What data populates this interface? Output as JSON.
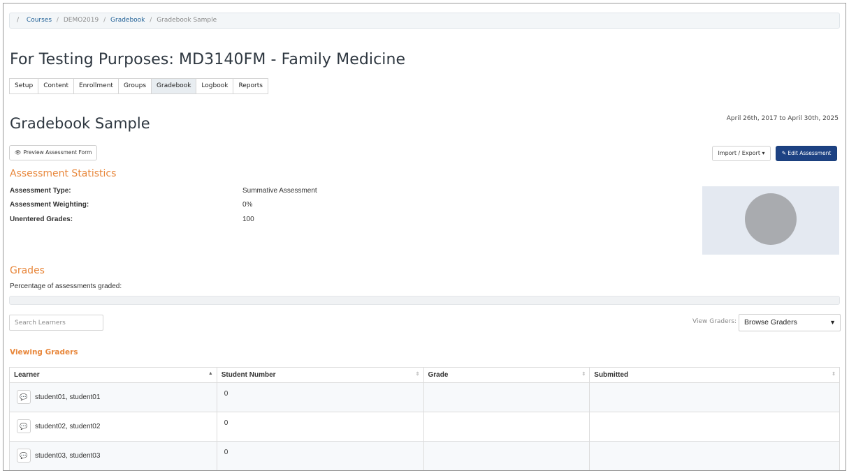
{
  "breadcrumb": {
    "lead_sep": "/",
    "items": [
      "Courses",
      "DEMO2019",
      "Gradebook",
      "Gradebook Sample"
    ],
    "sep": "/"
  },
  "course_title": "For Testing Purposes: MD3140FM - Family Medicine",
  "tabs": [
    "Setup",
    "Content",
    "Enrollment",
    "Groups",
    "Gradebook",
    "Logbook",
    "Reports"
  ],
  "active_tab": "Gradebook",
  "page_title": "Gradebook Sample",
  "date_range": "April 26th, 2017 to April 30th, 2025",
  "buttons": {
    "preview": "Preview Assessment Form",
    "import_export": "Import / Export",
    "edit": "Edit Assessment"
  },
  "stats": {
    "heading": "Assessment Statistics",
    "rows": [
      {
        "label": "Assessment Type:",
        "value": "Summative Assessment"
      },
      {
        "label": "Assessment Weighting:",
        "value": "0%"
      },
      {
        "label": "Unentered Grades:",
        "value": "100"
      }
    ]
  },
  "grades": {
    "heading": "Grades",
    "pct_label": "Percentage of assessments graded:",
    "pct_graded": 0
  },
  "search": {
    "placeholder": "Search Learners"
  },
  "view_graders": {
    "label": "View Graders:",
    "selected": "Browse Graders"
  },
  "viewing_graders_heading": "Viewing Graders",
  "table": {
    "headers": [
      "Learner",
      "Student Number",
      "Grade",
      "Submitted"
    ],
    "rows": [
      {
        "learner": "student01, student01",
        "student_number": "0",
        "grade": "",
        "submitted": ""
      },
      {
        "learner": "student02, student02",
        "student_number": "0",
        "grade": "",
        "submitted": ""
      },
      {
        "learner": "student03, student03",
        "student_number": "0",
        "grade": "",
        "submitted": ""
      }
    ]
  },
  "colors": {
    "accent_orange": "#e8873b",
    "primary_blue": "#1d4283",
    "chart_bg": "#e4e9f1",
    "chart_circle": "#a9abaf"
  }
}
